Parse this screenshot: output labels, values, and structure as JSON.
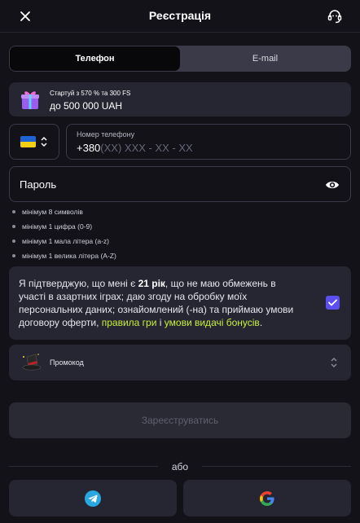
{
  "header": {
    "title": "Реєстрація",
    "close_icon": "close-icon",
    "support_icon": "headset-icon"
  },
  "tabs": [
    {
      "label": "Телефон",
      "active": true
    },
    {
      "label": "E-mail",
      "active": false
    }
  ],
  "bonus": {
    "icon": "gift-icon",
    "line1": "Стартуй з 570 % та 300 FS",
    "line2": "до 500 000 UAH"
  },
  "phone": {
    "country_flag": "ukraine-flag",
    "label": "Номер телефону",
    "prefix": "+380",
    "mask": "(XX) XXX - XX - XX"
  },
  "password": {
    "placeholder": "Пароль",
    "toggle_icon": "eye-icon"
  },
  "password_rules": [
    "мінімум 8 символів",
    "мінімум 1 цифра (0-9)",
    "мінімум 1 мала літера (a-z)",
    "мінімум 1 велика літера (A-Z)"
  ],
  "agreement": {
    "part1": "Я підтверджую, що мені є ",
    "age": "21 рік",
    "part2": ", що не маю обмежень в участі в азартних іграх; даю згоду на обробку моїх персональних даних; ознайомлений (-на) та приймаю умови договору оферти, ",
    "link1": "правила гри",
    "part3": " і ",
    "link2": "умови видачі бонусів",
    "part4": ".",
    "checked": true
  },
  "promo": {
    "label": "Промокод",
    "icon": "magic-hat-icon"
  },
  "submit_label": "Зареєструватись",
  "or_label": "або",
  "social": [
    {
      "name": "telegram",
      "icon": "telegram-icon"
    },
    {
      "name": "google",
      "icon": "google-icon"
    }
  ],
  "colors": {
    "background": "#121218",
    "card": "#262633",
    "accent": "#5b4ff0",
    "link": "#c8f03a",
    "telegram": "#2aa6e0"
  }
}
